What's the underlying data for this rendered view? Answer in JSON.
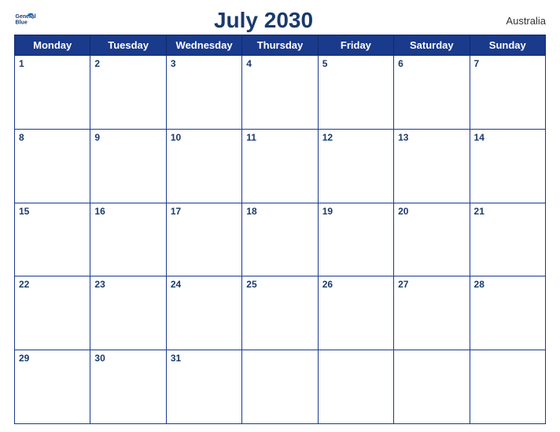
{
  "header": {
    "title": "July 2030",
    "country": "Australia",
    "logo_line1": "General",
    "logo_line2": "Blue"
  },
  "days_of_week": [
    "Monday",
    "Tuesday",
    "Wednesday",
    "Thursday",
    "Friday",
    "Saturday",
    "Sunday"
  ],
  "weeks": [
    [
      {
        "date": "1",
        "empty": false
      },
      {
        "date": "2",
        "empty": false
      },
      {
        "date": "3",
        "empty": false
      },
      {
        "date": "4",
        "empty": false
      },
      {
        "date": "5",
        "empty": false
      },
      {
        "date": "6",
        "empty": false
      },
      {
        "date": "7",
        "empty": false
      }
    ],
    [
      {
        "date": "8",
        "empty": false
      },
      {
        "date": "9",
        "empty": false
      },
      {
        "date": "10",
        "empty": false
      },
      {
        "date": "11",
        "empty": false
      },
      {
        "date": "12",
        "empty": false
      },
      {
        "date": "13",
        "empty": false
      },
      {
        "date": "14",
        "empty": false
      }
    ],
    [
      {
        "date": "15",
        "empty": false
      },
      {
        "date": "16",
        "empty": false
      },
      {
        "date": "17",
        "empty": false
      },
      {
        "date": "18",
        "empty": false
      },
      {
        "date": "19",
        "empty": false
      },
      {
        "date": "20",
        "empty": false
      },
      {
        "date": "21",
        "empty": false
      }
    ],
    [
      {
        "date": "22",
        "empty": false
      },
      {
        "date": "23",
        "empty": false
      },
      {
        "date": "24",
        "empty": false
      },
      {
        "date": "25",
        "empty": false
      },
      {
        "date": "26",
        "empty": false
      },
      {
        "date": "27",
        "empty": false
      },
      {
        "date": "28",
        "empty": false
      }
    ],
    [
      {
        "date": "29",
        "empty": false
      },
      {
        "date": "30",
        "empty": false
      },
      {
        "date": "31",
        "empty": false
      },
      {
        "date": "",
        "empty": true
      },
      {
        "date": "",
        "empty": true
      },
      {
        "date": "",
        "empty": true
      },
      {
        "date": "",
        "empty": true
      }
    ]
  ]
}
